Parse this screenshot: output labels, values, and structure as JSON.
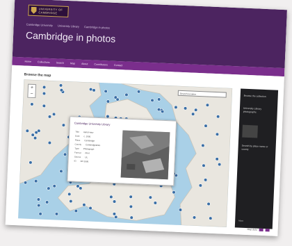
{
  "logo": {
    "text_line1": "UNIVERSITY OF",
    "text_line2": "CAMBRIDGE"
  },
  "breadcrumb": [
    "Cambridge University",
    "University Library",
    "Cambridge in photos"
  ],
  "site_title": "Cambridge in photos",
  "nav_items": [
    "Home",
    "Collections",
    "Search",
    "Map",
    "About",
    "Contributors",
    "Contact"
  ],
  "section_title": "Browse the map",
  "map": {
    "search_placeholder": "Search location",
    "zoom_in_label": "+",
    "zoom_out_label": "−",
    "colors": {
      "sea": "#a9d0e7",
      "land": "#e9e6df",
      "marker": "#3a6ea5"
    }
  },
  "popup": {
    "title": "Cambridge University Library",
    "fields": [
      {
        "label": "Title",
        "value": "Aerial view"
      },
      {
        "label": "Date",
        "value": "c. 1930"
      },
      {
        "label": "Place",
        "value": "Cambridge"
      },
      {
        "label": "County",
        "value": "Cambridgeshire"
      },
      {
        "label": "Type",
        "value": "Photograph"
      },
      {
        "label": "Format",
        "value": "Print"
      },
      {
        "label": "Source",
        "value": "UL"
      },
      {
        "label": "ID",
        "value": "AP-1930"
      }
    ]
  },
  "sidebar": {
    "heading": "Browse the collection",
    "text_1": "University Library photographs",
    "text_2": "Search by place name or county",
    "footer": "More"
  },
  "footer": {
    "text": "Map data"
  },
  "colors": {
    "header_purple": "#4c2460",
    "nav_purple": "#7a2e8c"
  }
}
